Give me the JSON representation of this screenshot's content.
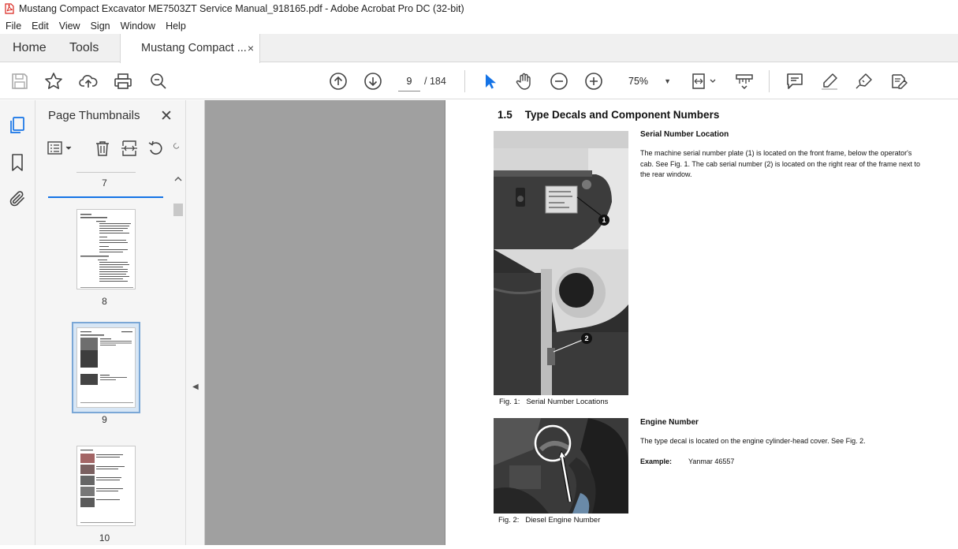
{
  "window": {
    "title": "Mustang Compact Excavator ME7503ZT Service Manual_918165.pdf - Adobe Acrobat Pro DC (32-bit)"
  },
  "menu": {
    "items": [
      "File",
      "Edit",
      "View",
      "Sign",
      "Window",
      "Help"
    ]
  },
  "tabs": {
    "home": "Home",
    "tools": "Tools",
    "document": "Mustang Compact ...",
    "close_glyph": "×"
  },
  "toolbar": {
    "page_current": "9",
    "page_total": "/ 184",
    "zoom": "75%",
    "zoom_caret": "▼"
  },
  "panel": {
    "title": "Page Thumbnails",
    "close_glyph": "✕",
    "thumbnails": [
      {
        "label": "7"
      },
      {
        "label": "8"
      },
      {
        "label": "9",
        "selected": true
      },
      {
        "label": "10"
      }
    ]
  },
  "document": {
    "section_number": "1.5",
    "section_title": "Type Decals and Component Numbers",
    "serial": {
      "heading": "Serial Number Location",
      "text": "The machine serial number plate (1) is located on the front frame, below the operator's cab. See Fig. 1. The cab serial number (2) is located on the right rear of the frame next to the rear window.",
      "badge1": "1",
      "badge2": "2",
      "caption_num": "Fig. 1:",
      "caption_text": "Serial Number Locations"
    },
    "engine": {
      "heading": "Engine Number",
      "text": "The type decal is located on the engine cylinder-head cover. See Fig. 2.",
      "example_label": "Example:",
      "example_value": "Yanmar 46557",
      "caption_num": "Fig. 2:",
      "caption_text": "Diesel Engine Number"
    }
  },
  "colors": {
    "accent": "#1473e6",
    "pdf_red": "#d9251d",
    "gray_canvas": "#a0a0a0"
  }
}
